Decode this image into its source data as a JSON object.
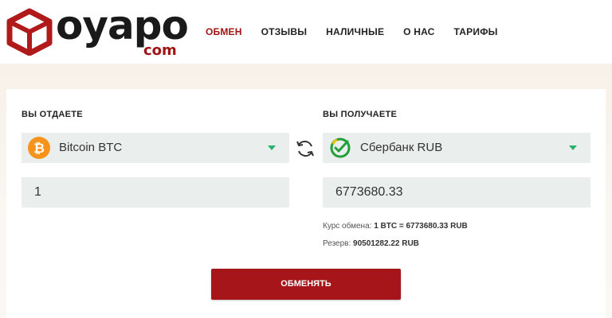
{
  "logo": {
    "name": "oyapo",
    "sub": "com"
  },
  "nav": [
    {
      "label": "ОБМЕН",
      "active": true
    },
    {
      "label": "ОТЗЫВЫ"
    },
    {
      "label": "НАЛИЧНЫЕ"
    },
    {
      "label": "О НАС"
    },
    {
      "label": "ТАРИФЫ"
    }
  ],
  "give": {
    "label": "ВЫ ОТДАЕТЕ",
    "currency": "Bitcoin BTC",
    "currency_icon": "bitcoin-icon",
    "amount": "1"
  },
  "receive": {
    "label": "ВЫ ПОЛУЧАЕТЕ",
    "currency": "Сбербанк RUB",
    "currency_icon": "sberbank-icon",
    "amount": "6773680.33"
  },
  "rate": {
    "label": "Курс обмена:",
    "value": "1 BTC = 6773680.33 RUB"
  },
  "reserve": {
    "label": "Резерв:",
    "value": "90501282.22 RUB"
  },
  "submit_label": "ОБМЕНЯТЬ",
  "colors": {
    "brand": "#a5151a",
    "accent_green": "#27b26b",
    "bitcoin": "#f7931a"
  }
}
